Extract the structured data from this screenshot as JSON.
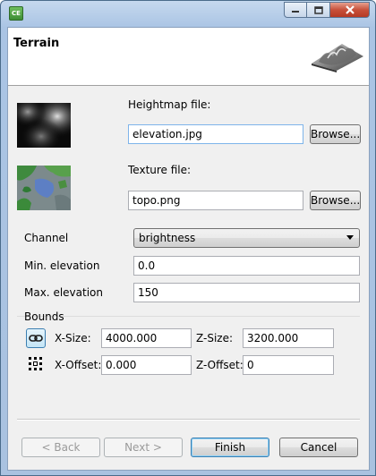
{
  "window": {
    "icon_text": "CE",
    "controls": {
      "minimize": "minimize-icon",
      "maximize": "maximize-icon",
      "close": "close-icon"
    }
  },
  "header": {
    "title": "Terrain",
    "image": "terrain-3d-icon"
  },
  "heightmap": {
    "label": "Heightmap file:",
    "value": "elevation.jpg",
    "browse_label": "Browse..."
  },
  "texture": {
    "label": "Texture file:",
    "value": "topo.png",
    "browse_label": "Browse..."
  },
  "channel": {
    "label": "Channel",
    "selected": "brightness"
  },
  "min_elevation": {
    "label": "Min. elevation",
    "value": "0.0"
  },
  "max_elevation": {
    "label": "Max. elevation",
    "value": "150"
  },
  "bounds": {
    "title": "Bounds",
    "x_size": {
      "label": "X-Size:",
      "value": "4000.000"
    },
    "z_size": {
      "label": "Z-Size:",
      "value": "3200.000"
    },
    "x_offset": {
      "label": "X-Offset:",
      "value": "0.000"
    },
    "z_offset": {
      "label": "Z-Offset:",
      "value": "0"
    },
    "link_icon": "link-icon",
    "grid_icon": "grid-icon"
  },
  "footer": {
    "back_label": "< Back",
    "next_label": "Next >",
    "finish_label": "Finish",
    "cancel_label": "Cancel"
  },
  "colors": {
    "frame": "#a9c2e0",
    "close_button": "#c7503a",
    "focus_border": "#7eb4ea",
    "default_button_border": "#3c7fb1"
  }
}
